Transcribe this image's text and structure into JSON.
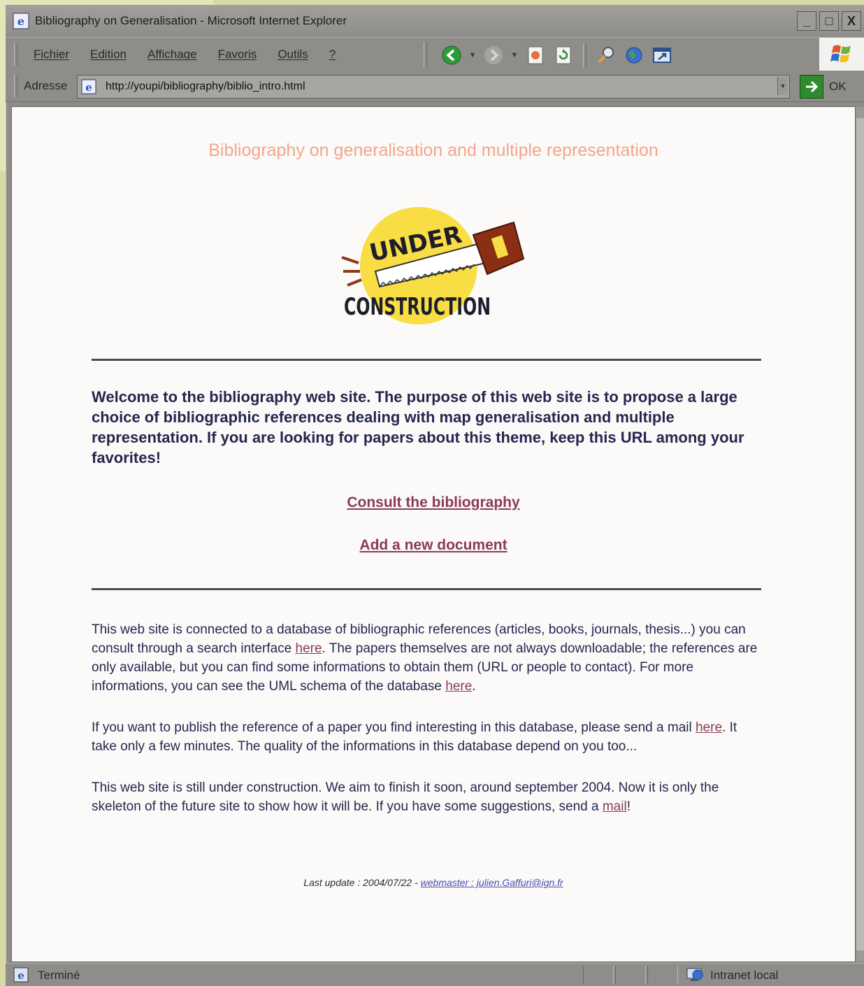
{
  "window": {
    "title": "Bibliography on Generalisation - Microsoft Internet Explorer",
    "buttons": {
      "minimize": "_",
      "maximize": "□",
      "close": "X"
    }
  },
  "menu": {
    "items": [
      "Fichier",
      "Edition",
      "Affichage",
      "Favoris",
      "Outils",
      "?"
    ]
  },
  "toolbar": {
    "icons": [
      "back-icon",
      "forward-icon",
      "stop-icon",
      "refresh-icon",
      "search-icon",
      "globe-icon",
      "window-icon"
    ]
  },
  "address": {
    "label": "Adresse",
    "url": "http://youpi/bibliography/biblio_intro.html",
    "go_label": "OK"
  },
  "page": {
    "title": "Bibliography on generalisation and multiple representation",
    "logo": {
      "top": "UNDER",
      "bottom": "CONSTRUCTION"
    },
    "welcome": "Welcome to the bibliography web site. The purpose of this web site is to propose a large choice of bibliographic references dealing with map generalisation and multiple representation. If you are looking for papers about this theme, keep this URL among your favorites!",
    "links": {
      "consult": "Consult the bibliography",
      "add": "Add a new document"
    },
    "para1": {
      "a": "This web site is connected to a database of bibliographic references (articles, books, journals, thesis...) you can consult through a search interface ",
      "link1": "here",
      "b": ". The papers themselves are not always downloadable; the references are only available, but you can find some informations to obtain them (URL or people to contact). For more informations, you can see the UML schema of the database ",
      "link2": "here",
      "c": "."
    },
    "para2": {
      "a": "If you want to publish the reference of a paper you find interesting in this database, please send a mail ",
      "link": "here",
      "b": ". It take only a few minutes. The quality of the informations in this database depend on you too..."
    },
    "para3": {
      "a": "This web site is still under construction. We aim to finish it soon, around september 2004. Now it is only the skeleton of the future site to show how it will be. If you have some suggestions, send a ",
      "link": "mail",
      "b": "!"
    },
    "footer": {
      "text": "Last update : 2004/07/22 - ",
      "link": "webmaster : julien.Gaffuri@ign.fr"
    }
  },
  "status": {
    "text": "Terminé",
    "zone": "Intranet local"
  },
  "colors": {
    "title": "#f3a58d",
    "link": "#8a3a5c",
    "text": "#262650",
    "chrome": "#8f8d8a"
  }
}
